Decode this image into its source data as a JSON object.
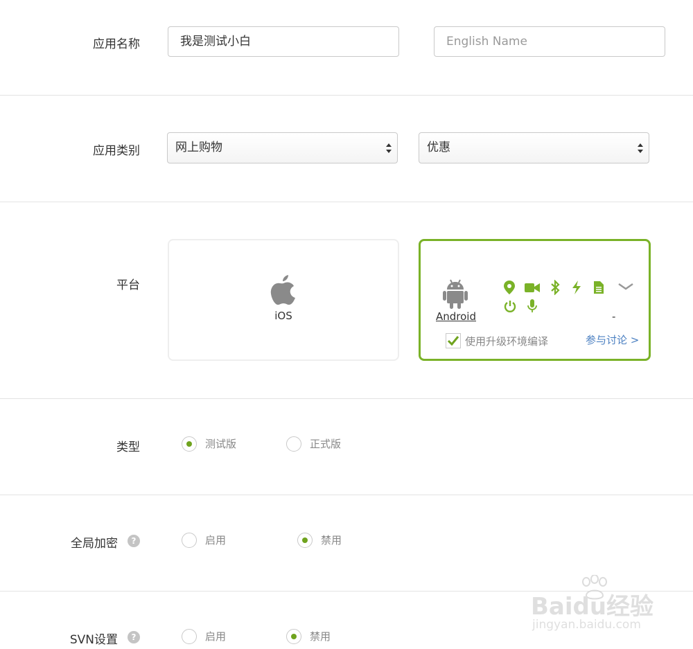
{
  "app_name": {
    "label": "应用名称",
    "value_cn": "我是测试小白",
    "placeholder_en": "English Name"
  },
  "category": {
    "label": "应用类别",
    "primary": "网上购物",
    "secondary": "优惠"
  },
  "platform": {
    "label": "平台",
    "ios_label": "iOS",
    "android_label": "Android",
    "android_dash": "-",
    "upgrade_checkbox_label": "使用升级环境编译",
    "upgrade_checked": true,
    "discuss_link": "参与讨论 >",
    "permission_icons": [
      "location-icon",
      "video-icon",
      "bluetooth-icon",
      "flash-icon",
      "file-icon",
      "expand-icon",
      "power-icon",
      "microphone-icon"
    ],
    "selected": "android"
  },
  "build_type": {
    "label": "类型",
    "options": [
      "测试版",
      "正式版"
    ],
    "selected": "测试版"
  },
  "encryption": {
    "label": "全局加密",
    "help": "?",
    "options": [
      "启用",
      "禁用"
    ],
    "selected": "禁用"
  },
  "svn": {
    "label": "SVN设置",
    "help": "?",
    "options": [
      "启用",
      "禁用"
    ],
    "selected": "禁用"
  },
  "watermark": {
    "brand": "Baidu经验",
    "url": "jingyan.baidu.com"
  },
  "colors": {
    "accent": "#7ab228",
    "link": "#4a7fc1",
    "border": "#c9c9c9"
  }
}
